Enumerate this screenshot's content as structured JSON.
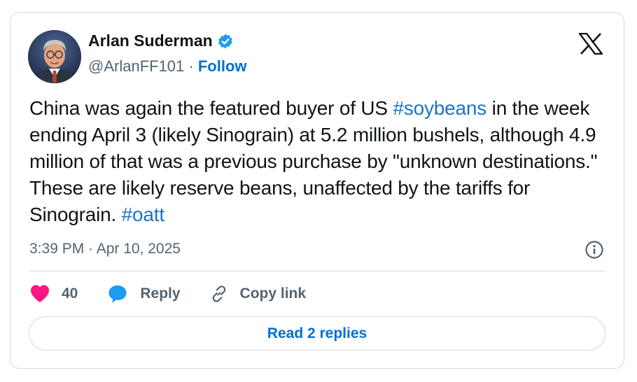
{
  "author": {
    "name": "Arlan Suderman",
    "handle": "@ArlanFF101",
    "separator": "·",
    "follow_label": "Follow",
    "verified": true,
    "avatar": "man-with-glasses-avatar"
  },
  "brand": {
    "logo": "x-logo-icon"
  },
  "tweet": {
    "part1": "China was again the featured buyer of US ",
    "hashtag1": "#soybeans",
    "part2": " in the week ending April 3 (likely Sinograin) at 5.2 million bushels, although 4.9 million of that was a previous purchase by \"unknown destinations.\" These are likely reserve beans, unaffected by the tariffs for Sinograin. ",
    "hashtag2": "#oatt"
  },
  "meta": {
    "timestamp": "3:39 PM · Apr 10, 2025",
    "info_icon": "info-icon"
  },
  "actions": {
    "like_count": "40",
    "reply_label": "Reply",
    "copy_label": "Copy link"
  },
  "replies_button": "Read 2 replies",
  "colors": {
    "accent": "#006fd6",
    "hashtag": "#1d73c9",
    "like": "#f91880",
    "reply_icon": "#1d9bf0",
    "verified": "#1d9bf0",
    "secondary_text": "#536471",
    "border": "#cfd9de"
  }
}
